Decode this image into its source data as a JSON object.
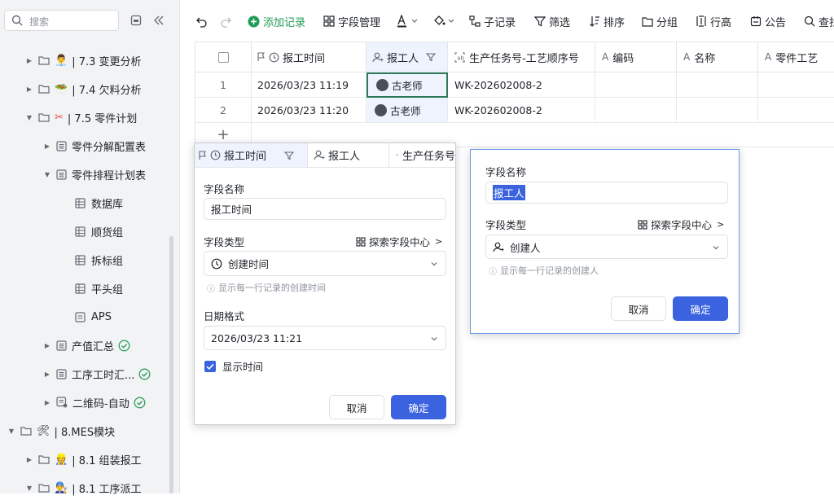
{
  "sidebar": {
    "search_placeholder": "搜索",
    "items": [
      {
        "label": "| 7.3 变更分析"
      },
      {
        "label": "| 7.4 欠料分析"
      },
      {
        "label": "| 7.5 零件计划"
      },
      {
        "label": "零件分解配置表"
      },
      {
        "label": "零件排程计划表"
      },
      {
        "label": "数据库"
      },
      {
        "label": "顺货组"
      },
      {
        "label": "拆标组"
      },
      {
        "label": "平头组"
      },
      {
        "label": "APS"
      },
      {
        "label": "产值汇总"
      },
      {
        "label": "工序工时汇..."
      },
      {
        "label": "二维码-自动"
      },
      {
        "label": "| 8.MES模块"
      },
      {
        "label": "| 8.1 组装报工"
      },
      {
        "label": "| 8.1 工序派工"
      }
    ]
  },
  "toolbar": {
    "add_record": "添加记录",
    "field_manage": "字段管理",
    "sub_record": "子记录",
    "filter": "筛选",
    "sort": "排序",
    "group": "分组",
    "row_height": "行高",
    "announcement": "公告",
    "find": "查找"
  },
  "grid": {
    "headers": [
      "报工时间",
      "报工人",
      "生产任务号-工艺顺序号",
      "编码",
      "名称",
      "零件工艺"
    ],
    "rows": [
      {
        "index": "1",
        "time": "2026/03/23 11:19",
        "person": "古老师",
        "task": "WK-202602008-2"
      },
      {
        "index": "2",
        "time": "2026/03/23 11:20",
        "person": "古老师",
        "task": "WK-202602008-2"
      }
    ],
    "add_row": "+"
  },
  "time_panel": {
    "tab_time": "报工时间",
    "tab_person": "报工人",
    "tab_task": "生产任务号",
    "field_name_label": "字段名称",
    "field_name_value": "报工时间",
    "field_type_label": "字段类型",
    "explore": "探索字段中心",
    "field_type_value": "创建时间",
    "hint": "显示每一行记录的创建时间",
    "date_format_label": "日期格式",
    "date_format_value": "2026/03/23 11:21",
    "show_time_label": "显示时间",
    "cancel": "取消",
    "confirm": "确定"
  },
  "person_panel": {
    "field_name_label": "字段名称",
    "field_name_value": "报工人",
    "field_type_label": "字段类型",
    "explore": "探索字段中心",
    "field_type_value": "创建人",
    "hint": "显示每一行记录的创建人",
    "cancel": "取消",
    "confirm": "确定"
  },
  "colors": {
    "accent": "#3b63df",
    "add_green": "#1f9d55",
    "check_green": "#2e9e5b"
  }
}
